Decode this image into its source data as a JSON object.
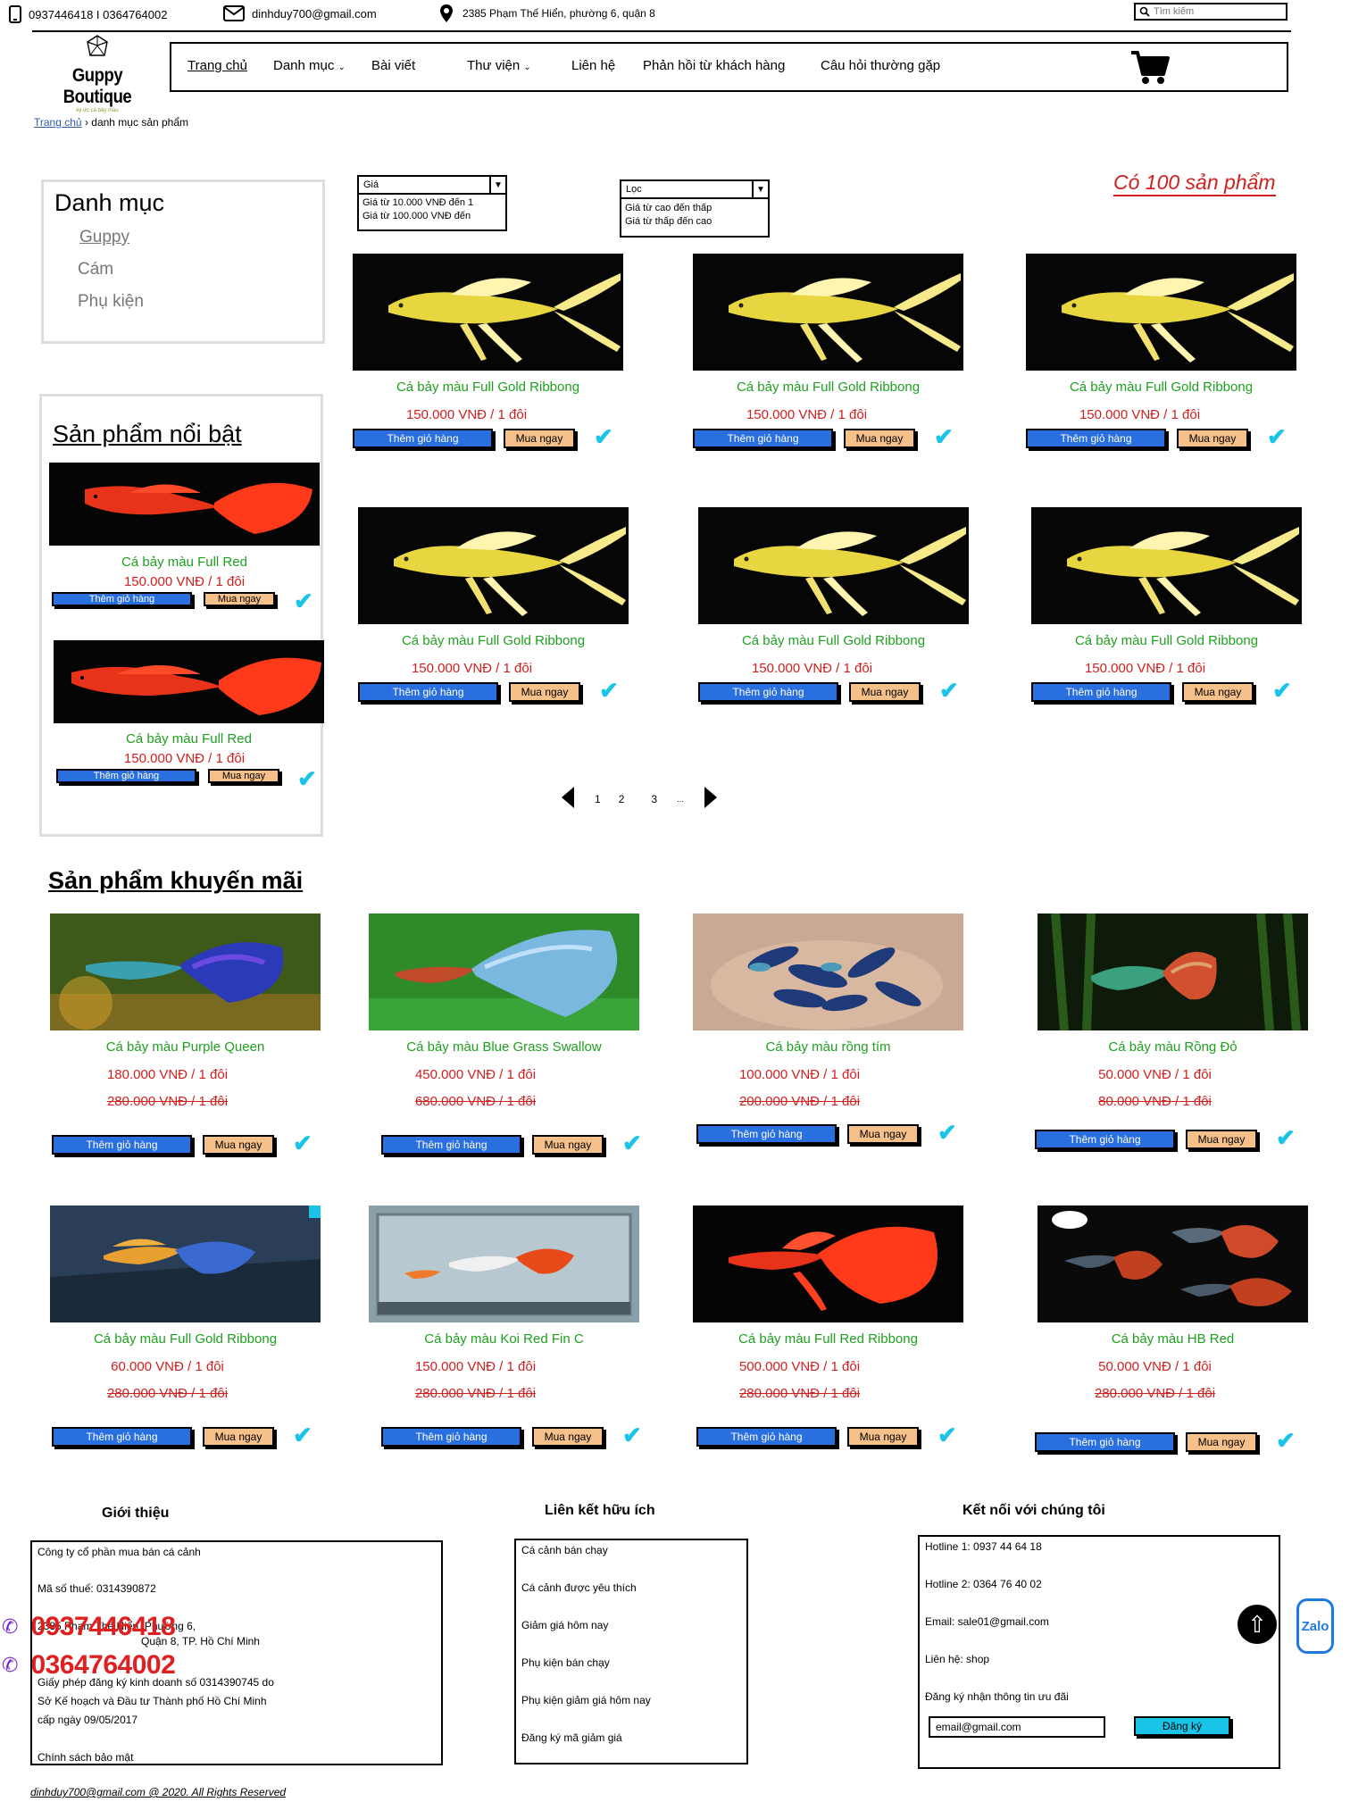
{
  "topbar": {
    "phones": "0937446418 I 0364764002",
    "email": "dinhduy700@gmail.com",
    "address": "2385 Phạm Thế Hiển, phường 6, quận 8",
    "search_placeholder": "Tìm kiếm"
  },
  "brand": {
    "name": "Guppy Boutique",
    "tagline": "ký ức cá bảy màu"
  },
  "nav": [
    "Trang chủ",
    "Danh mục",
    "Bài viết",
    "Thư viện",
    "Liên hệ",
    "Phản hồi từ khách hàng",
    "Câu hỏi thường gặp"
  ],
  "breadcrumb": {
    "home": "Trang chủ",
    "current": "danh mục sản phẩm"
  },
  "categories": {
    "title": "Danh mục",
    "items": [
      "Guppy",
      "Cám",
      "Phụ kiện"
    ]
  },
  "featured": {
    "title": "Sản phẩm nổi bật",
    "items": [
      {
        "name": "Cá bảy màu Full Red",
        "price": "150.000 VNĐ / 1 đôi"
      },
      {
        "name": "Cá bảy màu Full Red",
        "price": "150.000 VNĐ / 1 đôi"
      }
    ]
  },
  "filters": {
    "price": {
      "label": "Giá",
      "options": [
        "Giá từ 10.000 VNĐ đến 1",
        "Giá từ 100.000 VNĐ đến"
      ]
    },
    "sort": {
      "label": "Lọc",
      "options": [
        "Giá từ cao đến thấp",
        "Giá từ thấp đến cao"
      ]
    }
  },
  "product_count": "Có 100 sản phẩm",
  "products": [
    {
      "name": "Cá bảy màu Full Gold Ribbong",
      "price": "150.000 VNĐ / 1 đôi"
    },
    {
      "name": "Cá bảy màu Full Gold Ribbong",
      "price": "150.000 VNĐ / 1 đôi"
    },
    {
      "name": "Cá bảy màu Full Gold Ribbong",
      "price": "150.000 VNĐ / 1 đôi"
    },
    {
      "name": "Cá bảy màu Full Gold Ribbong",
      "price": "150.000 VNĐ / 1 đôi"
    },
    {
      "name": "Cá bảy màu Full Gold Ribbong",
      "price": "150.000 VNĐ / 1 đôi"
    },
    {
      "name": "Cá bảy màu Full Gold Ribbong",
      "price": "150.000 VNĐ / 1 đôi"
    }
  ],
  "buttons": {
    "add_to_cart": "Thêm giỏ hàng",
    "buy_now": "Mua ngay"
  },
  "pagination": [
    "1",
    "2",
    "3",
    "..."
  ],
  "promo": {
    "title": "Sản phẩm khuyến mãi",
    "items": [
      {
        "name": "Cá bảy màu Purple Queen",
        "price": "180.000 VNĐ / 1 đôi",
        "old": "280.000 VNĐ / 1 đôi"
      },
      {
        "name": "Cá bảy màu Blue Grass Swallow",
        "price": "450.000 VNĐ / 1 đôi",
        "old": "680.000 VNĐ / 1 đôi"
      },
      {
        "name": "Cá bảy màu rồng tím",
        "price": "100.000 VNĐ / 1 đôi",
        "old": "200.000 VNĐ / 1 đôi"
      },
      {
        "name": "Cá bảy màu Rồng Đỏ",
        "price": "50.000 VNĐ / 1 đôi",
        "old": "80.000 VNĐ / 1 đôi"
      },
      {
        "name": "Cá bảy màu Full Gold Ribbong",
        "price": "60.000 VNĐ / 1 đôi",
        "old": "280.000 VNĐ / 1 đôi"
      },
      {
        "name": "Cá bảy màu Koi Red Fin C",
        "price": "150.000 VNĐ / 1 đôi",
        "old": "280.000 VNĐ / 1 đôi"
      },
      {
        "name": "Cá bảy màu Full Red Ribbong",
        "price": "500.000 VNĐ / 1 đôi",
        "old": "280.000 VNĐ / 1 đôi"
      },
      {
        "name": "Cá bảy màu HB Red",
        "price": "50.000 VNĐ / 1 đôi",
        "old": "280.000 VNĐ / 1 đôi"
      }
    ]
  },
  "footer": {
    "intro": {
      "title": "Giới thiệu",
      "lines": [
        "Công ty cổ phần mua bán cá cảnh",
        "Mã số thuế: 0314390872",
        "2385 Phạm Thế Hiển, Phường 6,",
        "Quận 8, TP. Hồ Chí Minh",
        "Giấy phép đăng ký kinh doanh số 0314390745 do",
        "Sở Kế hoạch và Đầu tư Thành phố Hồ Chí Minh",
        "cấp ngày 09/05/2017",
        "Chính sách bảo mật"
      ]
    },
    "links": {
      "title": "Liên kết hữu ích",
      "items": [
        "Cá cảnh bán chạy",
        "Cá cảnh được yêu thích",
        "Giảm giá hôm nay",
        "Phụ kiện bán chạy",
        "Phụ kiện giảm giá hôm nay",
        "Đăng ký mã giảm giá"
      ]
    },
    "connect": {
      "title": "Kết nối với chúng tôi",
      "lines": [
        "Hotline 1: 0937 44 64 18",
        "Hotline 2: 0364 76 40 02",
        "Email: sale01@gmail.com",
        "Liên hệ: shop",
        "Đăng ký nhận thông tin ưu đãi"
      ],
      "email_value": "email@gmail.com",
      "subscribe": "Đăng ký"
    },
    "hotlines": [
      "0937446418",
      "0364764002"
    ],
    "zalo": "Zalo",
    "copyright": "dinhduy700@gmail.com @ 2020. All Rights Reserved"
  }
}
